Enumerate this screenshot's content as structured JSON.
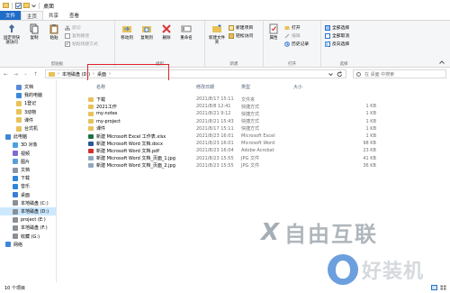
{
  "window": {
    "title": "桌面"
  },
  "ribbon": {
    "tabs": [
      "文件",
      "主页",
      "共享",
      "查看"
    ],
    "clipboard": {
      "pin": "固定到快速访问",
      "copy": "复制",
      "paste": "粘贴",
      "cut": "剪切",
      "copy_path": "复制路径",
      "paste_shortcut": "粘贴快捷方式",
      "label": "剪贴板"
    },
    "organize": {
      "move_to": "移动到",
      "copy_to": "复制到",
      "delete": "删除",
      "rename": "重命名",
      "label": "组织"
    },
    "new": {
      "new_folder": "新建文件夹",
      "new_item": "新建项目",
      "easy_access": "轻松访问",
      "label": "新建"
    },
    "open": {
      "properties": "属性",
      "open": "打开",
      "edit": "编辑",
      "history": "历史记录",
      "label": "打开"
    },
    "select": {
      "select_all": "全部选择",
      "select_none": "全部取消",
      "invert": "反向选择",
      "label": "选择"
    }
  },
  "address": {
    "crumbs": [
      "本地磁盘 (D:)",
      "桌面"
    ],
    "search_placeholder": "在 桌面 中搜索",
    "highlight_color": "#e0202a"
  },
  "nav": {
    "items": [
      {
        "label": "文档",
        "icon": "document-icon",
        "color": "#5b8ad6"
      },
      {
        "label": "我的电脑",
        "icon": "computer-icon",
        "color": "#3c88d8"
      },
      {
        "label": "1登记",
        "icon": "folder-icon",
        "color": "#e8c15a"
      },
      {
        "label": "3动物",
        "icon": "folder-icon",
        "color": "#e8c15a"
      },
      {
        "label": "课件",
        "icon": "folder-icon",
        "color": "#e8c15a"
      },
      {
        "label": "台式机",
        "icon": "folder-icon",
        "color": "#e8c15a"
      },
      {
        "label": "此电脑",
        "icon": "pc-icon",
        "color": "#3c88d8"
      },
      {
        "label": "3D 对象",
        "icon": "3d-objects-icon",
        "color": "#4aa0e0"
      },
      {
        "label": "视频",
        "icon": "video-icon",
        "color": "#7f6bd0"
      },
      {
        "label": "图片",
        "icon": "picture-icon",
        "color": "#5aa0d8"
      },
      {
        "label": "文档",
        "icon": "document-icon",
        "color": "#8a96a8"
      },
      {
        "label": "下载",
        "icon": "download-icon",
        "color": "#2f86d6"
      },
      {
        "label": "音乐",
        "icon": "music-icon",
        "color": "#2f86d6"
      },
      {
        "label": "桌面",
        "icon": "desktop-icon",
        "color": "#3a7fd2"
      },
      {
        "label": "本地磁盘 (C:)",
        "icon": "drive-icon",
        "color": "#8a8f96"
      },
      {
        "label": "本地磁盘 (D:)",
        "icon": "drive-icon",
        "color": "#8a8f96"
      },
      {
        "label": "project (E:)",
        "icon": "drive-icon",
        "color": "#8a8f96"
      },
      {
        "label": "本地磁盘 (F:)",
        "icon": "drive-icon",
        "color": "#8a8f96"
      },
      {
        "label": "收藏 (G:)",
        "icon": "drive-icon",
        "color": "#8a8f96"
      },
      {
        "label": "网络",
        "icon": "network-icon",
        "color": "#3c88d8"
      }
    ]
  },
  "files": {
    "columns": {
      "name": "名称",
      "date": "修改日期",
      "type": "类型",
      "size": "大小"
    },
    "rows": [
      {
        "name": "下载",
        "date": "2021/8/17 15:11",
        "type": "文件夹",
        "size": "",
        "icon": "folder-icon",
        "color": "#e8c15a"
      },
      {
        "name": "2021工作",
        "date": "2021/8/8 12:41",
        "type": "快捷方式",
        "size": "1 KB",
        "icon": "shortcut-icon",
        "color": "#e8c15a"
      },
      {
        "name": "my-notes",
        "date": "2021/8/21 9:12",
        "type": "快捷方式",
        "size": "1 KB",
        "icon": "shortcut-icon",
        "color": "#e8c15a"
      },
      {
        "name": "my-project",
        "date": "2021/8/21 15:43",
        "type": "快捷方式",
        "size": "1 KB",
        "icon": "shortcut-icon",
        "color": "#e8c15a"
      },
      {
        "name": "课件",
        "date": "2021/8/17 15:11",
        "type": "快捷方式",
        "size": "1 KB",
        "icon": "shortcut-icon",
        "color": "#e8c15a"
      },
      {
        "name": "新建 Microsoft Excel 工作表.xlsx",
        "date": "2021/8/23 16:01",
        "type": "Microsoft Excel",
        "size": "1 KB",
        "icon": "excel-icon",
        "color": "#1e7145"
      },
      {
        "name": "新建 Microsoft Word 文档.docx",
        "date": "2021/8/23 16:01",
        "type": "Microsoft Word",
        "size": "98 KB",
        "icon": "word-icon",
        "color": "#2b579a"
      },
      {
        "name": "新建 Microsoft Word 文档.pdf",
        "date": "2021/8/23 16:04",
        "type": "Adobe Acrobat",
        "size": "23 KB",
        "icon": "pdf-icon",
        "color": "#d32f2f"
      },
      {
        "name": "新建 Microsoft Word 文档_页面_1.jpg",
        "date": "2021/8/23 15:55",
        "type": "JPG 文件",
        "size": "41 KB",
        "icon": "image-icon",
        "color": "#8fa7c0"
      },
      {
        "name": "新建 Microsoft Word 文档_页面_2.jpg",
        "date": "2021/8/23 15:55",
        "type": "JPG 文件",
        "size": "36 KB",
        "icon": "image-icon",
        "color": "#8fa7c0"
      }
    ]
  },
  "status": {
    "item_count": "10 个项目"
  },
  "watermark": {
    "brand_top": "自由互联",
    "brand_bottom": "好装机"
  }
}
